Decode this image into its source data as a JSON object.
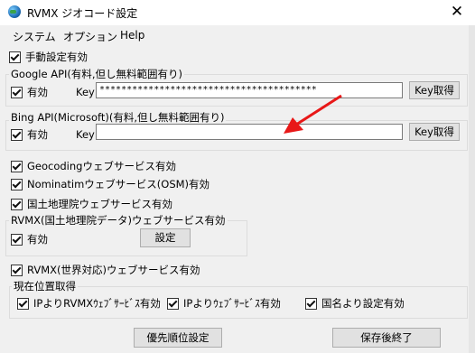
{
  "window": {
    "title": "RVMX ジオコード設定",
    "close_glyph": "✕"
  },
  "menu": [
    "システム",
    "オプション",
    "Help"
  ],
  "manual": {
    "label": "手動設定有効",
    "checked": true
  },
  "google": {
    "group_label": "Google API(有料,但し無料範囲有り)",
    "enabled_label": "有効",
    "key_label": "Key",
    "key_value": "****************************************",
    "button": "Key取得"
  },
  "bing": {
    "group_label": "Bing API(Microsoft)(有料,但し無料範囲有り)",
    "enabled_label": "有効",
    "key_label": "Key",
    "key_value": "",
    "button": "Key取得"
  },
  "services": [
    {
      "label": "Geocodingウェブサービス有効",
      "checked": true
    },
    {
      "label": "Nominatimウェブサービス(OSM)有効",
      "checked": true
    },
    {
      "label": "国土地理院ウェブサービス有効",
      "checked": true
    }
  ],
  "rvmx_gsi": {
    "group_label": "RVMX(国土地理院データ)ウェブサービス有効",
    "enabled_label": "有効",
    "button": "設定"
  },
  "rvmx_world": {
    "label": "RVMX(世界対応)ウェブサービス有効",
    "checked": true
  },
  "location": {
    "group_label": "現在位置取得",
    "options": [
      {
        "label": "IPよりRVMXｳｪﾌﾞｻｰﾋﾞｽ有効",
        "checked": true
      },
      {
        "label": "IPよりｳｪﾌﾞｻｰﾋﾞｽ有効",
        "checked": true
      },
      {
        "label": "国名より設定有効",
        "checked": true
      }
    ]
  },
  "buttons": {
    "priority": "優先順位設定",
    "save_exit": "保存後終了"
  },
  "colors": {
    "arrow": "#e81818",
    "window_bg": "#f0f0f0"
  }
}
